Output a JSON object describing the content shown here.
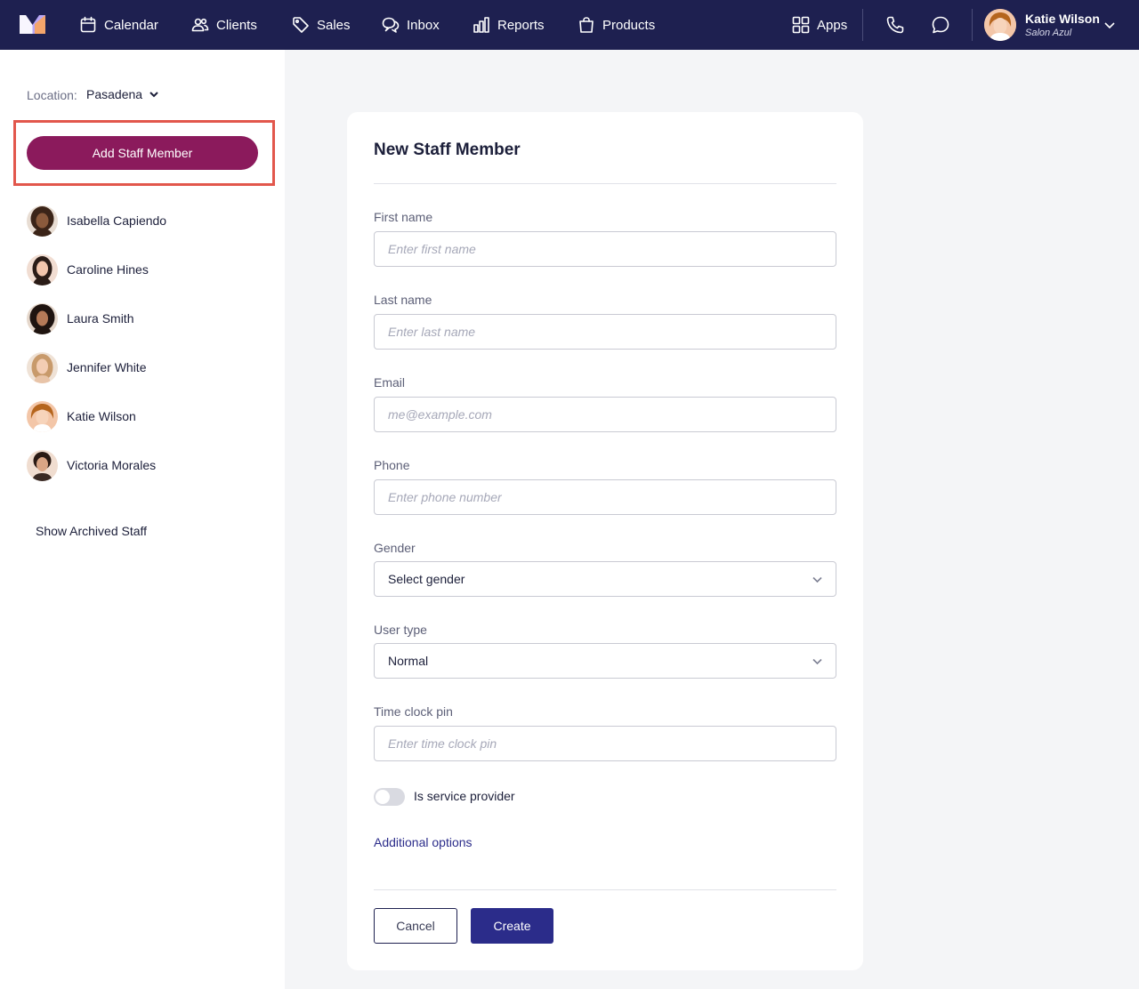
{
  "nav": {
    "items": [
      {
        "label": "Calendar",
        "icon": "calendar-icon"
      },
      {
        "label": "Clients",
        "icon": "users-icon"
      },
      {
        "label": "Sales",
        "icon": "tag-icon"
      },
      {
        "label": "Inbox",
        "icon": "chat-bubbles-icon"
      },
      {
        "label": "Reports",
        "icon": "bar-chart-icon"
      },
      {
        "label": "Products",
        "icon": "shopping-bag-icon"
      }
    ],
    "apps_label": "Apps",
    "user": {
      "name": "Katie Wilson",
      "business": "Salon Azul"
    }
  },
  "sidebar": {
    "location_label": "Location:",
    "location_value": "Pasadena",
    "add_button": "Add Staff Member",
    "staff": [
      {
        "name": "Isabella Capiendo"
      },
      {
        "name": "Caroline Hines"
      },
      {
        "name": "Laura Smith"
      },
      {
        "name": "Jennifer White"
      },
      {
        "name": "Katie Wilson"
      },
      {
        "name": "Victoria Morales"
      }
    ],
    "archived_link": "Show Archived Staff"
  },
  "form": {
    "title": "New Staff Member",
    "first_name": {
      "label": "First name",
      "placeholder": "Enter first name",
      "value": ""
    },
    "last_name": {
      "label": "Last name",
      "placeholder": "Enter last name",
      "value": ""
    },
    "email": {
      "label": "Email",
      "placeholder": "me@example.com",
      "value": ""
    },
    "phone": {
      "label": "Phone",
      "placeholder": "Enter phone number",
      "value": ""
    },
    "gender": {
      "label": "Gender",
      "value": "Select gender"
    },
    "user_type": {
      "label": "User type",
      "value": "Normal"
    },
    "pin": {
      "label": "Time clock pin",
      "placeholder": "Enter time clock pin",
      "value": ""
    },
    "service_provider": {
      "label": "Is service provider",
      "checked": false
    },
    "additional_options": "Additional options",
    "cancel": "Cancel",
    "create": "Create"
  },
  "colors": {
    "nav_bg": "#1e2050",
    "primary_button": "#8b1a5c",
    "create_button": "#2b2c8a",
    "highlight": "#e2574c"
  }
}
